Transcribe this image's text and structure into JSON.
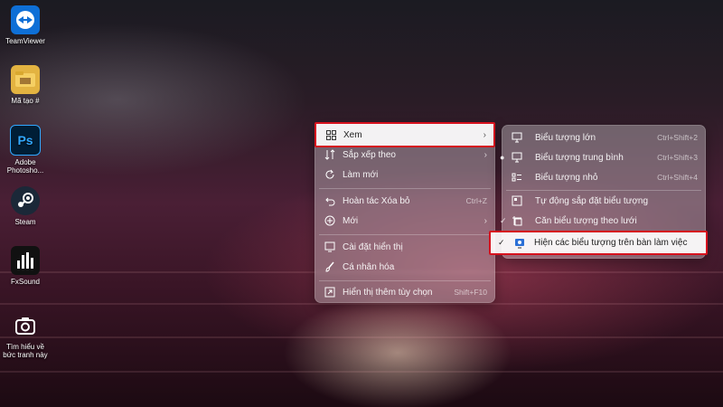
{
  "desktop": {
    "icons": [
      {
        "label": "TeamViewer",
        "icon": "teamviewer-icon"
      },
      {
        "label": "Mã tạo #",
        "icon": "folder-icon"
      },
      {
        "label": "Adobe Photosho...",
        "icon": "photoshop-icon"
      },
      {
        "label": "Steam",
        "icon": "steam-icon"
      },
      {
        "label": "FxSound",
        "icon": "fxsound-icon"
      },
      {
        "label": "Tìm hiểu về bức tranh này",
        "icon": "camera-icon"
      }
    ]
  },
  "context_menu": {
    "items": [
      {
        "label": "Xem",
        "icon": "grid-icon",
        "has_submenu": true,
        "highlighted": true
      },
      {
        "label": "Sắp xếp theo",
        "icon": "sort-icon",
        "has_submenu": true
      },
      {
        "label": "Làm mới",
        "icon": "refresh-icon"
      },
      {
        "label": "Hoàn tác Xóa bỏ",
        "icon": "undo-icon",
        "shortcut": "Ctrl+Z"
      },
      {
        "label": "Mới",
        "icon": "plus-circle-icon",
        "has_submenu": true
      },
      {
        "label": "Cài đặt hiển thị",
        "icon": "display-icon"
      },
      {
        "label": "Cá nhân hóa",
        "icon": "brush-icon"
      },
      {
        "label": "Hiển thị thêm tùy chọn",
        "icon": "share-icon",
        "shortcut": "Shift+F10"
      }
    ]
  },
  "view_submenu": {
    "items": [
      {
        "label": "Biểu tượng lớn",
        "icon": "monitor-icon",
        "shortcut": "Ctrl+Shift+2"
      },
      {
        "label": "Biểu tượng trung bình",
        "icon": "monitor-icon",
        "shortcut": "Ctrl+Shift+3",
        "selected_dot": true
      },
      {
        "label": "Biểu tượng nhỏ",
        "icon": "list-icon",
        "shortcut": "Ctrl+Shift+4"
      },
      {
        "label": "Tự động sắp đặt biểu tượng",
        "icon": "auto-arrange-icon"
      },
      {
        "label": "Căn biểu tượng theo lưới",
        "icon": "align-grid-icon",
        "checked": true
      },
      {
        "label": "Hiện các biểu tượng trên bàn làm việc",
        "icon": "desktop-show-icon",
        "checked": true,
        "highlighted": true
      }
    ]
  },
  "colors": {
    "highlight_border": "#d6121e"
  }
}
